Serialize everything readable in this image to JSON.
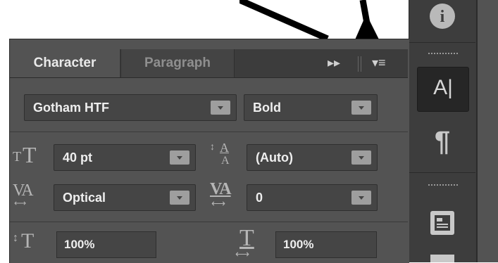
{
  "tabs": [
    {
      "label": "Character"
    },
    {
      "label": "Paragraph"
    }
  ],
  "panel_controls": {
    "collapse_glyph": "▸▸",
    "menu_glyph": "▾≡"
  },
  "font": {
    "family": "Gotham HTF",
    "style": "Bold"
  },
  "size_row": {
    "font_size": "40 pt",
    "leading": "(Auto)"
  },
  "kerning_row": {
    "kerning": "Optical",
    "tracking": "0"
  },
  "scale_row": {
    "vertical_scale": "100%",
    "horizontal_scale": "100%"
  },
  "icon_glyphs": {
    "font_size_icon": "T",
    "leading_icon": "A",
    "kerning_icon": "VA",
    "tracking_icon": "VA",
    "vertical_scale_icon": "T",
    "horizontal_scale_icon": "T",
    "character_dock": "A|",
    "paragraph_dock": "¶",
    "info_dock": "i"
  },
  "colors": {
    "panel_bg": "#535353",
    "tab_bar_bg": "#3c3c3c",
    "field_bg": "#454545",
    "dock_bg": "#3d3d3d"
  }
}
